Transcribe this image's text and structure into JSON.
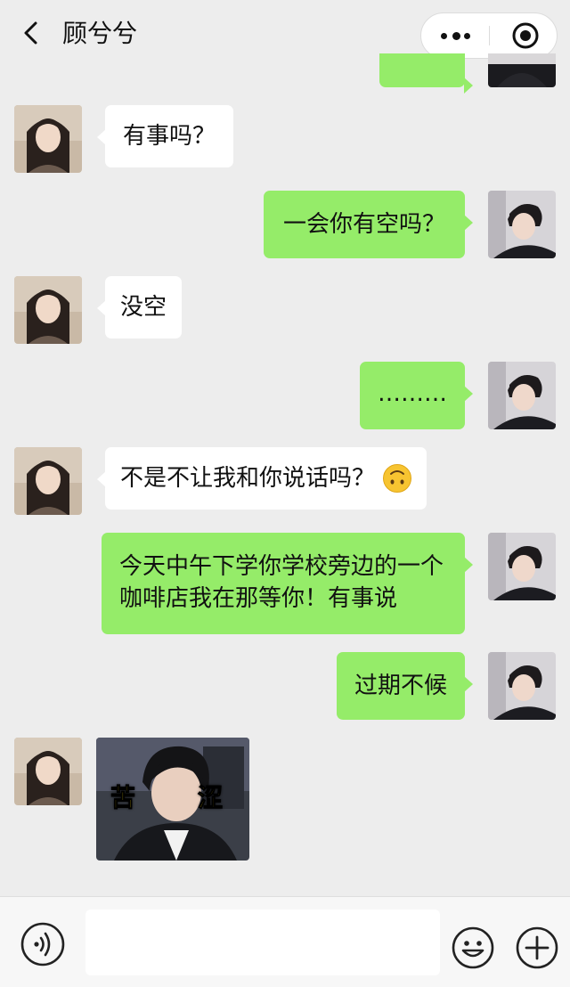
{
  "header": {
    "title": "顾兮兮",
    "back_icon": "chevron-left-icon",
    "more_icon": "more-dots-icon",
    "record_icon": "record-target-icon"
  },
  "messages": [
    {
      "side": "right",
      "text": "",
      "partial": true
    },
    {
      "side": "left",
      "text": "有事吗？"
    },
    {
      "side": "right",
      "text": "一会你有空吗？"
    },
    {
      "side": "left",
      "text": "没空"
    },
    {
      "side": "right",
      "text": "………"
    },
    {
      "side": "left",
      "text": "不是不让我和你说话吗？",
      "emoji": "upside-down-face-icon"
    },
    {
      "side": "right",
      "lines": [
        "今天中午下学你学校旁边的一个",
        "咖啡店我在那等你！有事说"
      ]
    },
    {
      "side": "right",
      "text": "过期不候"
    },
    {
      "side": "left",
      "type": "sticker",
      "sticker_text_left": "苦",
      "sticker_text_right": "涩"
    }
  ],
  "bottom_bar": {
    "voice_icon": "voice-icon",
    "input_value": "",
    "emoji_icon": "emoji-smile-icon",
    "plus_icon": "plus-icon"
  },
  "colors": {
    "background": "#ededed",
    "bubble_self": "#95ec69",
    "bubble_other": "#ffffff"
  }
}
